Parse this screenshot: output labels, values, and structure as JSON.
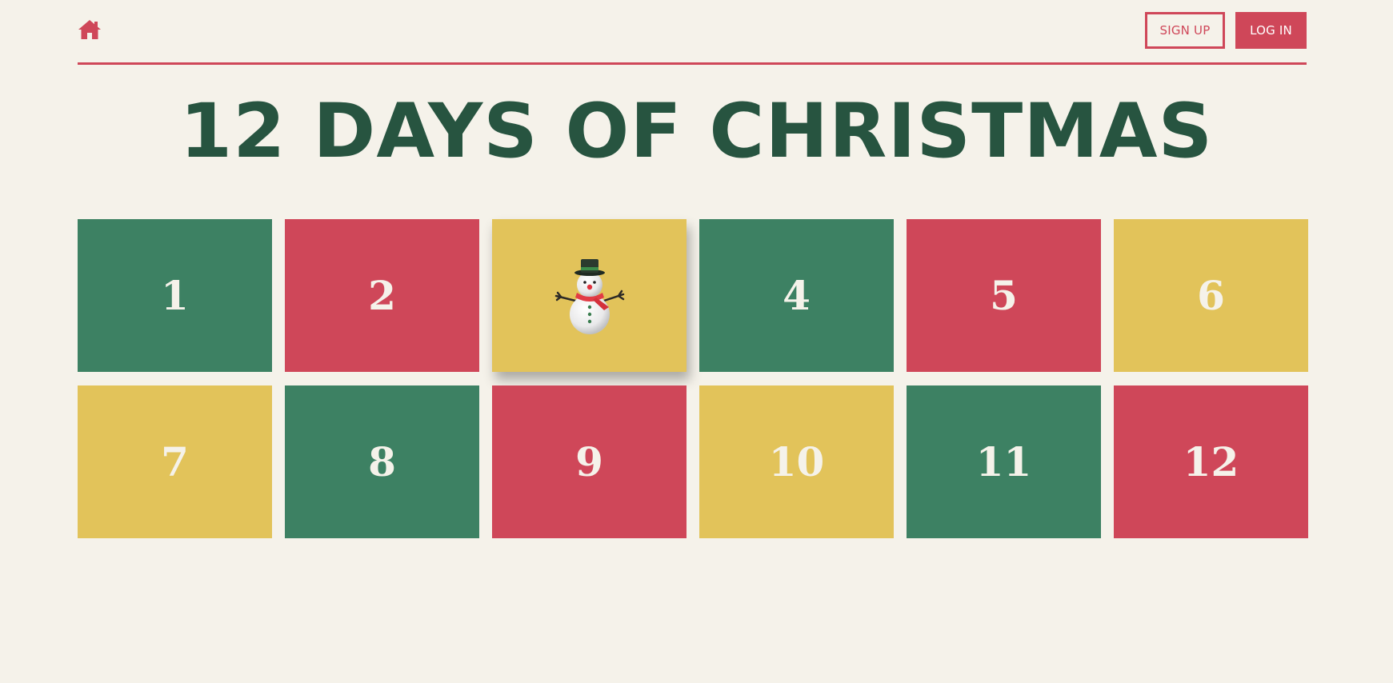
{
  "header": {
    "home_icon": "home-icon",
    "signup_label": "SIGN UP",
    "login_label": "LOG IN"
  },
  "title": "12 DAYS OF CHRISTMAS",
  "colors": {
    "background": "#f5f2ea",
    "accent_red": "#cf4759",
    "green": "#3d8163",
    "yellow": "#e2c35a",
    "title_green": "#275440"
  },
  "doors": [
    {
      "label": "1",
      "color": "green",
      "opened": false
    },
    {
      "label": "2",
      "color": "red",
      "opened": false
    },
    {
      "label": "",
      "color": "yellow",
      "opened": true,
      "icon": "snowman-icon"
    },
    {
      "label": "4",
      "color": "green",
      "opened": false
    },
    {
      "label": "5",
      "color": "red",
      "opened": false
    },
    {
      "label": "6",
      "color": "yellow",
      "opened": false
    },
    {
      "label": "7",
      "color": "yellow",
      "opened": false
    },
    {
      "label": "8",
      "color": "green",
      "opened": false
    },
    {
      "label": "9",
      "color": "red",
      "opened": false
    },
    {
      "label": "10",
      "color": "yellow",
      "opened": false
    },
    {
      "label": "11",
      "color": "green",
      "opened": false
    },
    {
      "label": "12",
      "color": "red",
      "opened": false
    }
  ]
}
